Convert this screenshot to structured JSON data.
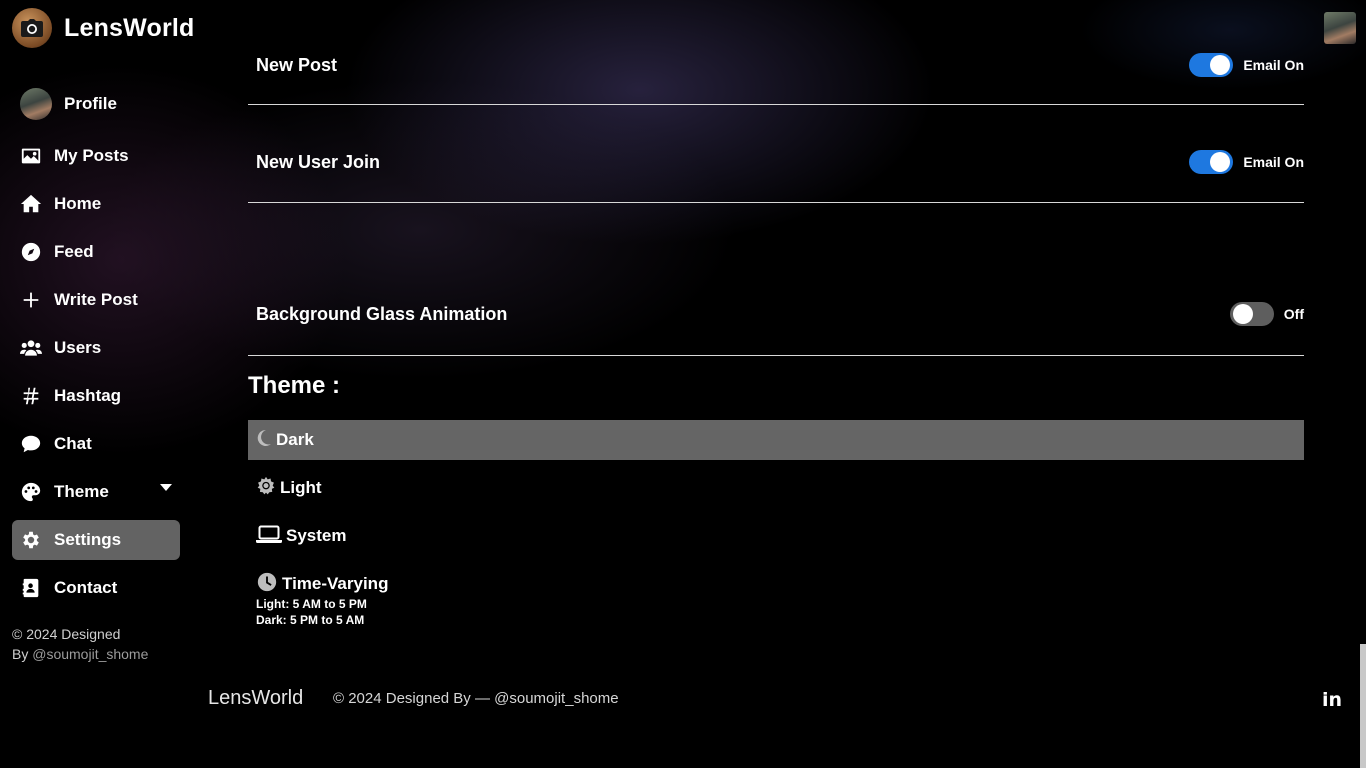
{
  "app": {
    "name": "LensWorld"
  },
  "sidebar": {
    "items": [
      {
        "label": "Profile",
        "icon": "user-avatar"
      },
      {
        "label": "My Posts",
        "icon": "image-icon"
      },
      {
        "label": "Home",
        "icon": "home-icon"
      },
      {
        "label": "Feed",
        "icon": "compass-icon"
      },
      {
        "label": "Write Post",
        "icon": "plus-icon"
      },
      {
        "label": "Users",
        "icon": "users-icon"
      },
      {
        "label": "Hashtag",
        "icon": "hashtag-icon"
      },
      {
        "label": "Chat",
        "icon": "chat-icon"
      },
      {
        "label": "Theme",
        "icon": "palette-icon"
      },
      {
        "label": "Settings",
        "icon": "gear-icon",
        "active": true
      },
      {
        "label": "Contact",
        "icon": "contact-icon"
      }
    ],
    "footer_line1": "© 2024 Designed",
    "footer_by": "By ",
    "footer_handle": "@soumojit_shome"
  },
  "settings": {
    "rows": [
      {
        "label": "New Post",
        "toggle_on": true,
        "status": "Email On"
      },
      {
        "label": "New User Join",
        "toggle_on": true,
        "status": "Email On"
      },
      {
        "label": "Background Glass Animation",
        "toggle_on": false,
        "status": "Off"
      }
    ],
    "theme_title": "Theme :",
    "theme_options": [
      {
        "label": "Dark",
        "icon": "moon-icon",
        "selected": true
      },
      {
        "label": "Light",
        "icon": "sun-gear-icon"
      },
      {
        "label": "System",
        "icon": "laptop-icon"
      },
      {
        "label": "Time-Varying",
        "icon": "clock-icon"
      }
    ],
    "time_varying_light": "Light: 5 AM to 5 PM",
    "time_varying_dark": "Dark: 5 PM to 5 AM"
  },
  "footer": {
    "brand": "LensWorld",
    "copyright": "© 2024 Designed By — @soumojit_shome",
    "linkedin_icon": "in"
  },
  "colors": {
    "toggle_on": "#1e78e0",
    "toggle_off": "#5e5e5e",
    "selected_bg": "#656565",
    "active_nav_bg": "#636363"
  }
}
